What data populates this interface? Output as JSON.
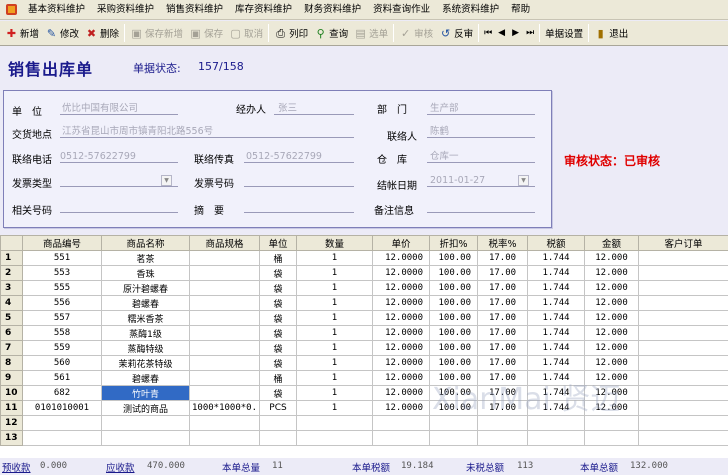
{
  "menu": [
    "基本资料维护",
    "采购资料维护",
    "销售资料维护",
    "库存资料维护",
    "财务资料维护",
    "资料查询作业",
    "系统资料维护",
    "帮助"
  ],
  "toolbar": {
    "add": "新增",
    "edit": "修改",
    "delete": "删除",
    "save_new": "保存新增",
    "save": "保存",
    "cancel": "取消",
    "print": "列印",
    "query": "查询",
    "select": "选单",
    "audit": "审核",
    "unaudit": "反审",
    "settings": "单据设置",
    "exit": "退出"
  },
  "form": {
    "title": "销售出库单",
    "doc_status_label": "单据状态:",
    "doc_status_value": "157/158",
    "fields": {
      "unit_label": "单　位",
      "unit_value": "优比中国有限公司",
      "handler_label": "经办人",
      "handler_value": "张三",
      "dept_label": "部　门",
      "dept_value": "生产部",
      "delivery_label": "交货地点",
      "delivery_value": "江苏省昆山市周市镇青阳北路556号",
      "contact_label": "联络人",
      "contact_value": "陈鹤",
      "phone_label": "联络电话",
      "phone_value": "0512-57622799",
      "fax_label": "联络传真",
      "fax_value": "0512-57622799",
      "warehouse_label": "仓　库",
      "warehouse_value": "仓库一",
      "invoice_type_label": "发票类型",
      "invoice_type_value": "",
      "invoice_no_label": "发票号码",
      "invoice_no_value": "",
      "settle_date_label": "结帐日期",
      "settle_date_value": "2011-01-27",
      "ref_no_label": "相关号码",
      "ref_no_value": "",
      "summary_label": "摘　要",
      "summary_value": "",
      "remark_label": "备注信息",
      "remark_value": ""
    },
    "audit_status": "审核状态：已审核"
  },
  "grid": {
    "columns": [
      "商品编号",
      "商品名称",
      "商品规格",
      "单位",
      "数量",
      "单价",
      "折扣%",
      "税率%",
      "税额",
      "金额",
      "客户订单"
    ],
    "rows": [
      {
        "no": "1",
        "code": "551",
        "name": "茗茶",
        "spec": "",
        "unit": "桶",
        "qty": "1",
        "price": "12.0000",
        "discount": "100.00",
        "tax_rate": "17.00",
        "tax": "1.744",
        "amount": "12.000",
        "order": ""
      },
      {
        "no": "2",
        "code": "553",
        "name": "香珠",
        "spec": "",
        "unit": "袋",
        "qty": "1",
        "price": "12.0000",
        "discount": "100.00",
        "tax_rate": "17.00",
        "tax": "1.744",
        "amount": "12.000",
        "order": ""
      },
      {
        "no": "3",
        "code": "555",
        "name": "原汁碧螺春",
        "spec": "",
        "unit": "袋",
        "qty": "1",
        "price": "12.0000",
        "discount": "100.00",
        "tax_rate": "17.00",
        "tax": "1.744",
        "amount": "12.000",
        "order": ""
      },
      {
        "no": "4",
        "code": "556",
        "name": "碧螺春",
        "spec": "",
        "unit": "袋",
        "qty": "1",
        "price": "12.0000",
        "discount": "100.00",
        "tax_rate": "17.00",
        "tax": "1.744",
        "amount": "12.000",
        "order": ""
      },
      {
        "no": "5",
        "code": "557",
        "name": "糯米香茶",
        "spec": "",
        "unit": "袋",
        "qty": "1",
        "price": "12.0000",
        "discount": "100.00",
        "tax_rate": "17.00",
        "tax": "1.744",
        "amount": "12.000",
        "order": ""
      },
      {
        "no": "6",
        "code": "558",
        "name": "蒸酶1级",
        "spec": "",
        "unit": "袋",
        "qty": "1",
        "price": "12.0000",
        "discount": "100.00",
        "tax_rate": "17.00",
        "tax": "1.744",
        "amount": "12.000",
        "order": ""
      },
      {
        "no": "7",
        "code": "559",
        "name": "蒸酶特级",
        "spec": "",
        "unit": "袋",
        "qty": "1",
        "price": "12.0000",
        "discount": "100.00",
        "tax_rate": "17.00",
        "tax": "1.744",
        "amount": "12.000",
        "order": ""
      },
      {
        "no": "8",
        "code": "560",
        "name": "茉莉花茶特级",
        "spec": "",
        "unit": "袋",
        "qty": "1",
        "price": "12.0000",
        "discount": "100.00",
        "tax_rate": "17.00",
        "tax": "1.744",
        "amount": "12.000",
        "order": ""
      },
      {
        "no": "9",
        "code": "561",
        "name": "碧螺春",
        "spec": "",
        "unit": "桶",
        "qty": "1",
        "price": "12.0000",
        "discount": "100.00",
        "tax_rate": "17.00",
        "tax": "1.744",
        "amount": "12.000",
        "order": ""
      },
      {
        "no": "10",
        "code": "682",
        "name": "竹叶青",
        "spec": "",
        "unit": "袋",
        "qty": "1",
        "price": "12.0000",
        "discount": "100.00",
        "tax_rate": "17.00",
        "tax": "1.744",
        "amount": "12.000",
        "order": ""
      },
      {
        "no": "11",
        "code": "0101010001",
        "name": "测试的商品",
        "spec": "1000*1000*0.",
        "unit": "PCS",
        "qty": "1",
        "price": "12.0000",
        "discount": "100.00",
        "tax_rate": "17.00",
        "tax": "1.744",
        "amount": "12.000",
        "order": ""
      },
      {
        "no": "12",
        "code": "",
        "name": "",
        "spec": "",
        "unit": "",
        "qty": "",
        "price": "",
        "discount": "",
        "tax_rate": "",
        "tax": "",
        "amount": "",
        "order": ""
      },
      {
        "no": "13",
        "code": "",
        "name": "",
        "spec": "",
        "unit": "",
        "qty": "",
        "price": "",
        "discount": "",
        "tax_rate": "",
        "tax": "",
        "amount": "",
        "order": ""
      }
    ]
  },
  "footer": {
    "prepaid_label": "预收款",
    "prepaid_value": "0.000",
    "receivable_label": "应收款",
    "receivable_value": "470.000",
    "total_qty_label": "本单总量",
    "total_qty_value": "11",
    "total_tax_label": "本单税额",
    "total_tax_value": "19.184",
    "untaxed_label": "未税总额",
    "untaxed_value": "113",
    "total_amount_label": "本单总额",
    "total_amount_value": "132.000"
  },
  "watermark": "XianMai 贤迈",
  "colors": {
    "title": "#1a1a8c",
    "audit": "#e00000",
    "selection": "#316ac5"
  }
}
